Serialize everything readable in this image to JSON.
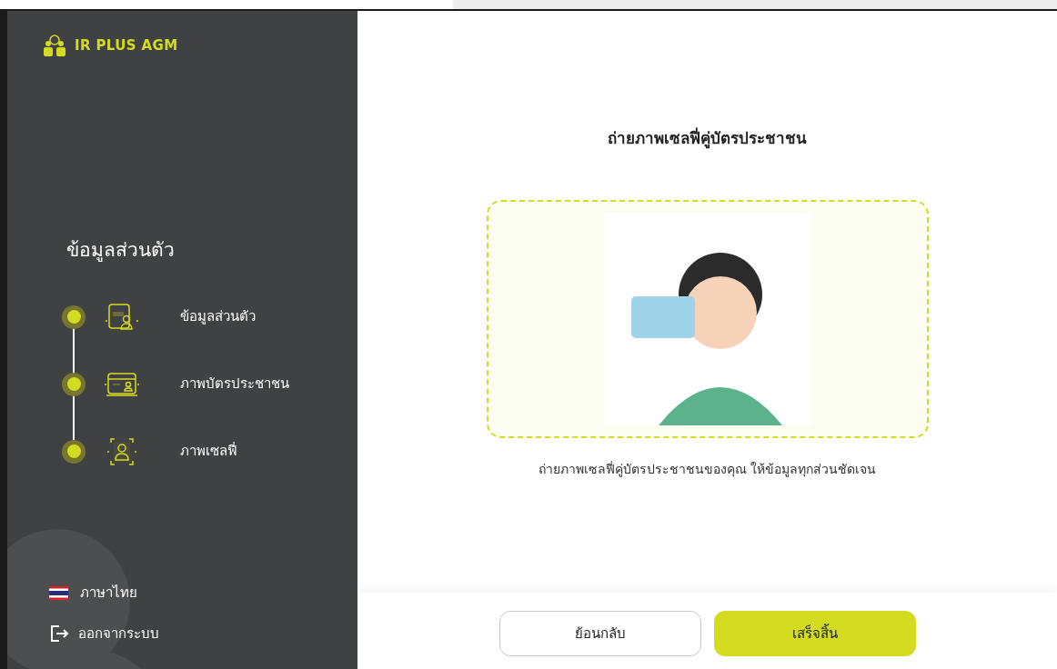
{
  "sidebar": {
    "logo_text": "IR PLUS AGM",
    "section_title": "ข้อมูลส่วนตัว",
    "steps": [
      {
        "kind": "profile",
        "label": "ข้อมูลส่วนตัว"
      },
      {
        "kind": "idcard",
        "label": "ภาพบัตรประชาชน"
      },
      {
        "kind": "selfie",
        "label": "ภาพเซลฟี่"
      }
    ],
    "language": "ภาษาไทย",
    "logout": "ออกจากระบบ"
  },
  "main": {
    "title": "ถ่ายภาพเซลฟี่คู่บัตรประชาชน",
    "instruction": "ถ่ายภาพเซลฟี่คู่บัตรประชาชนของคุณ ให้ข้อมูลทุกส่วนชัดเจน"
  },
  "buttons": [
    {
      "kind": "secondary",
      "label": "ย้อนกลับ"
    },
    {
      "kind": "primary",
      "label": "เสร็จสิ้น"
    }
  ]
}
